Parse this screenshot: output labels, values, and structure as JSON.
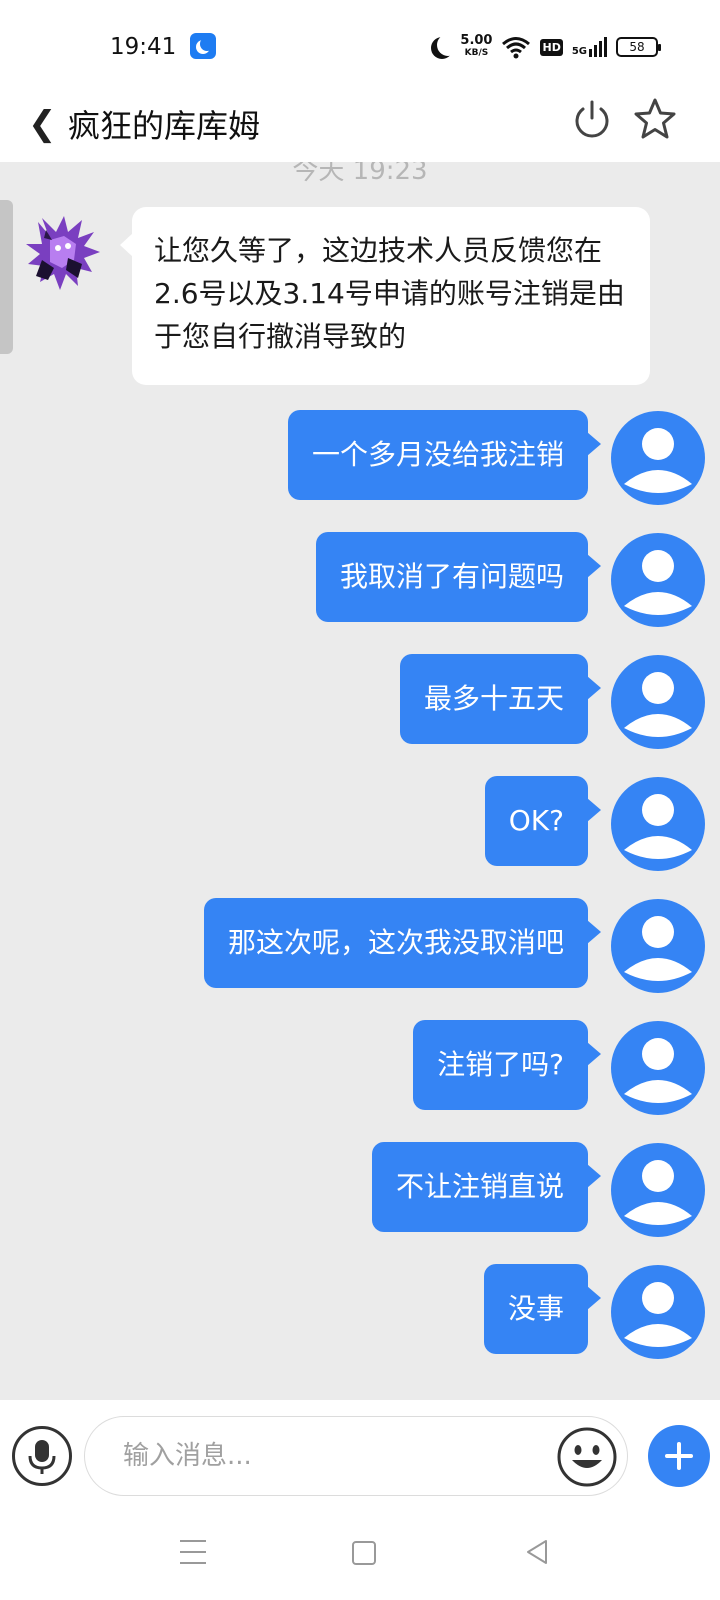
{
  "status_bar": {
    "time": "19:41",
    "net_speed_value": "5.00",
    "net_speed_unit": "KB/S",
    "hd_label": "HD",
    "network_label": "5G",
    "battery_level": "58",
    "icons": [
      "moon-badge-icon",
      "moon-icon",
      "wifi-icon",
      "hd-icon",
      "signal-icon",
      "battery-icon"
    ]
  },
  "header": {
    "back_icon": "chevron-left-icon",
    "title": "疯狂的库库姆",
    "power_icon": "power-icon",
    "star_icon": "star-icon"
  },
  "chat": {
    "timestamp": "今天 19:23",
    "incoming": {
      "avatar": "purple-creature-avatar",
      "text": "让您久等了，这边技术人员反馈您在2.6号以及3.14号申请的账号注销是由于您自行撤消导致的"
    },
    "outgoing": [
      {
        "text": "一个多月没给我注销"
      },
      {
        "text": "我取消了有问题吗"
      },
      {
        "text": "最多十五天"
      },
      {
        "text": "OK?"
      },
      {
        "text": "那这次呢，这次我没取消吧"
      },
      {
        "text": "注销了吗?"
      },
      {
        "text": "不让注销直说"
      },
      {
        "text": "没事"
      }
    ],
    "colors": {
      "user_bubble": "#3584f4",
      "bot_bubble": "#ffffff",
      "background": "#ebebeb"
    }
  },
  "input_bar": {
    "mic_icon": "microphone-icon",
    "placeholder": "输入消息...",
    "emoji_icon": "smiley-icon",
    "plus_icon": "plus-icon"
  },
  "nav_bar": {
    "icons": [
      "menu-icon",
      "home-icon",
      "back-triangle-icon"
    ]
  }
}
